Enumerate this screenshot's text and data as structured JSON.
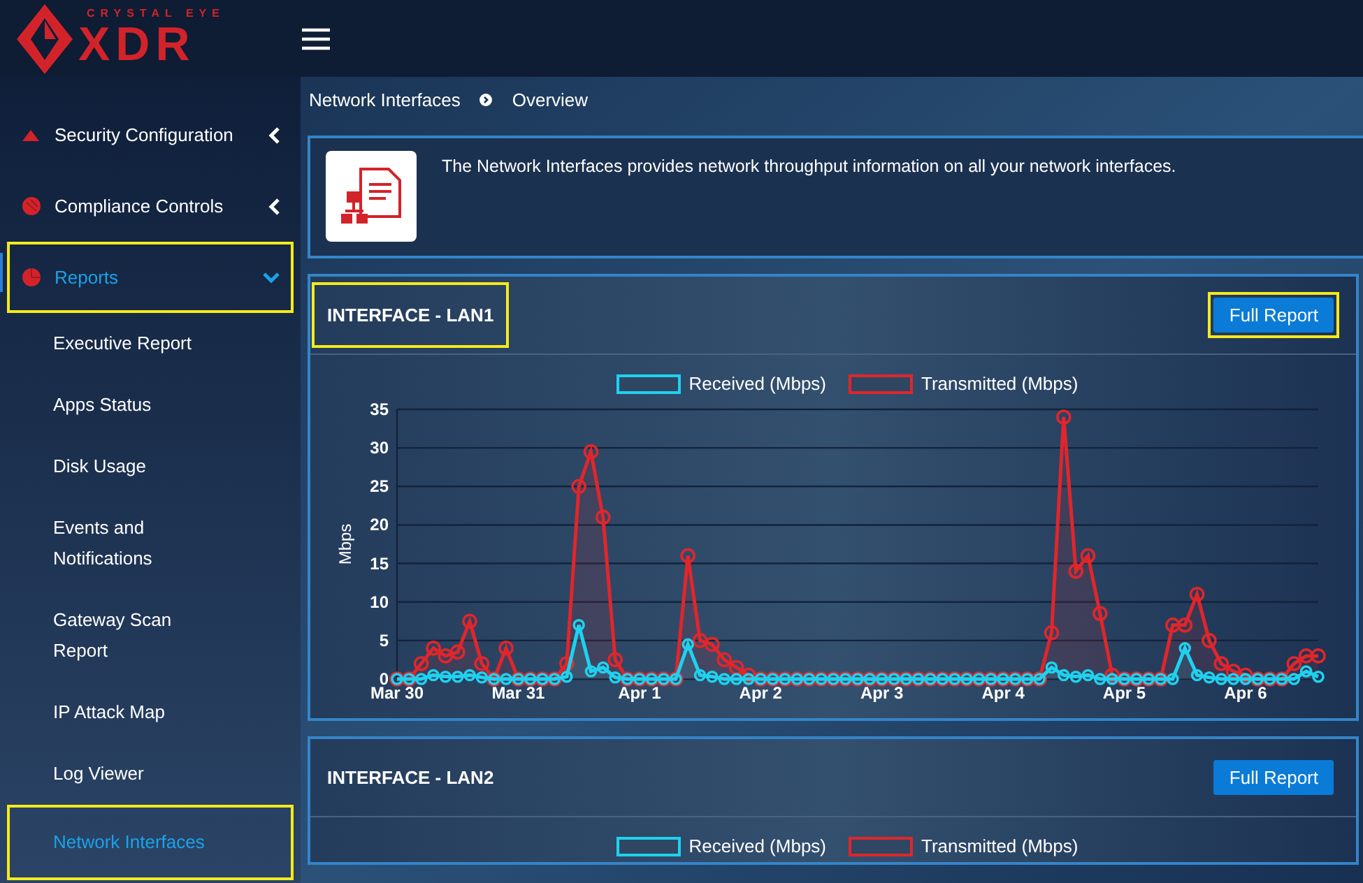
{
  "logo": {
    "top_text": "CRYSTAL EYE",
    "main_text": "XDR"
  },
  "sidebar": {
    "items": [
      {
        "label": "Security Configuration",
        "kind": "parent",
        "expanded": false,
        "selected": false,
        "highlighted": false
      },
      {
        "label": "Compliance Controls",
        "kind": "parent",
        "expanded": false,
        "selected": false,
        "highlighted": false
      },
      {
        "label": "Reports",
        "kind": "parent",
        "expanded": true,
        "selected": true,
        "highlighted": true,
        "children": [
          {
            "label": "Executive Report",
            "selected": false,
            "highlighted": false
          },
          {
            "label": "Apps Status",
            "selected": false,
            "highlighted": false
          },
          {
            "label": "Disk Usage",
            "selected": false,
            "highlighted": false
          },
          {
            "label": "Events and Notifications",
            "selected": false,
            "highlighted": false
          },
          {
            "label": "Gateway Scan Report",
            "selected": false,
            "highlighted": false
          },
          {
            "label": "IP Attack Map",
            "selected": false,
            "highlighted": false
          },
          {
            "label": "Log Viewer",
            "selected": false,
            "highlighted": false
          },
          {
            "label": "Network Interfaces",
            "selected": true,
            "highlighted": true
          }
        ]
      }
    ]
  },
  "breadcrumb": [
    "Network Interfaces",
    "Overview"
  ],
  "info": {
    "text": "The Network Interfaces provides network throughput information on all your network interfaces."
  },
  "panels": [
    {
      "title": "INTERFACE - LAN1",
      "title_highlighted": true,
      "button": "Full Report",
      "button_highlighted": true,
      "chart_data": {
        "type": "line",
        "ylabel": "Mbps",
        "ylim": [
          0,
          35
        ],
        "grid": true,
        "legend": "top",
        "yticks": [
          0,
          5,
          10,
          15,
          20,
          25,
          30,
          35
        ],
        "categories": [
          "Mar 30",
          null,
          null,
          null,
          null,
          null,
          null,
          null,
          null,
          null,
          "Mar 31",
          null,
          null,
          null,
          null,
          null,
          null,
          null,
          null,
          null,
          "Apr 1",
          null,
          null,
          null,
          null,
          null,
          null,
          null,
          null,
          null,
          "Apr 2",
          null,
          null,
          null,
          null,
          null,
          null,
          null,
          null,
          null,
          "Apr 3",
          null,
          null,
          null,
          null,
          null,
          null,
          null,
          null,
          null,
          "Apr 4",
          null,
          null,
          null,
          null,
          null,
          null,
          null,
          null,
          null,
          "Apr 5",
          null,
          null,
          null,
          null,
          null,
          null,
          null,
          null,
          null,
          "Apr 6",
          null,
          null,
          null,
          null,
          null,
          null
        ],
        "series": [
          {
            "name": "Received (Mbps)",
            "color": "#1ed2ef",
            "marker": "circle",
            "values": [
              0,
              0,
              0,
              0.5,
              0.3,
              0.3,
              0.5,
              0.2,
              0,
              0,
              0,
              0,
              0,
              0,
              0.3,
              7,
              1,
              1.5,
              0.2,
              0,
              0,
              0,
              0,
              0,
              4.5,
              0.5,
              0.3,
              0,
              0,
              0,
              0,
              0,
              0,
              0,
              0,
              0,
              0,
              0,
              0,
              0,
              0,
              0,
              0,
              0,
              0,
              0,
              0,
              0,
              0,
              0,
              0,
              0,
              0,
              0,
              1.5,
              0.5,
              0.3,
              0.5,
              0,
              0,
              0,
              0,
              0,
              0,
              0,
              4,
              0.5,
              0.2,
              0,
              0,
              0,
              0,
              0,
              0,
              0,
              1,
              0.3
            ]
          },
          {
            "name": "Transmitted (Mbps)",
            "color": "#e0262b",
            "marker": "circle",
            "values": [
              0,
              0,
              2,
              4,
              3,
              3.5,
              7.5,
              2,
              0,
              4,
              0,
              0,
              0,
              0,
              2,
              25,
              29.5,
              21,
              2.5,
              0,
              0,
              0,
              0,
              0,
              16,
              5,
              4.5,
              2.5,
              1.5,
              0.5,
              0,
              0,
              0,
              0,
              0,
              0,
              0,
              0,
              0,
              0,
              0,
              0,
              0,
              0,
              0,
              0,
              0,
              0,
              0,
              0,
              0,
              0,
              0,
              0,
              6,
              34,
              14,
              16,
              8.5,
              0.5,
              0,
              0,
              0,
              0,
              7,
              7,
              11,
              5,
              2,
              1,
              0.5,
              0,
              0,
              0,
              2,
              3,
              3
            ]
          }
        ]
      }
    },
    {
      "title": "INTERFACE - LAN2",
      "title_highlighted": false,
      "button": "Full Report",
      "button_highlighted": false,
      "legend": [
        {
          "name": "Received (Mbps)",
          "color": "#1ed2ef"
        },
        {
          "name": "Transmitted (Mbps)",
          "color": "#e0262b"
        }
      ]
    }
  ]
}
